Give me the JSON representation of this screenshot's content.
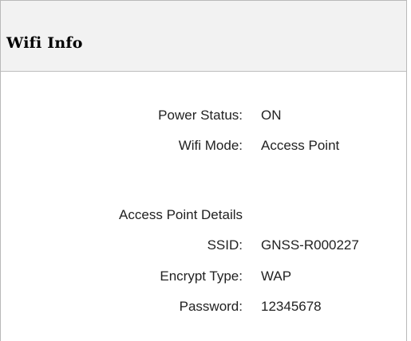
{
  "header": {
    "title": "Wifi Info"
  },
  "status": {
    "power_label": "Power Status:",
    "power_value": "ON",
    "mode_label": "Wifi Mode:",
    "mode_value": "Access Point"
  },
  "ap_details": {
    "heading": "Access Point Details",
    "ssid_label": "SSID:",
    "ssid_value": "GNSS-R000227",
    "encrypt_label": "Encrypt Type:",
    "encrypt_value": "WAP",
    "password_label": "Password:",
    "password_value": "12345678"
  }
}
